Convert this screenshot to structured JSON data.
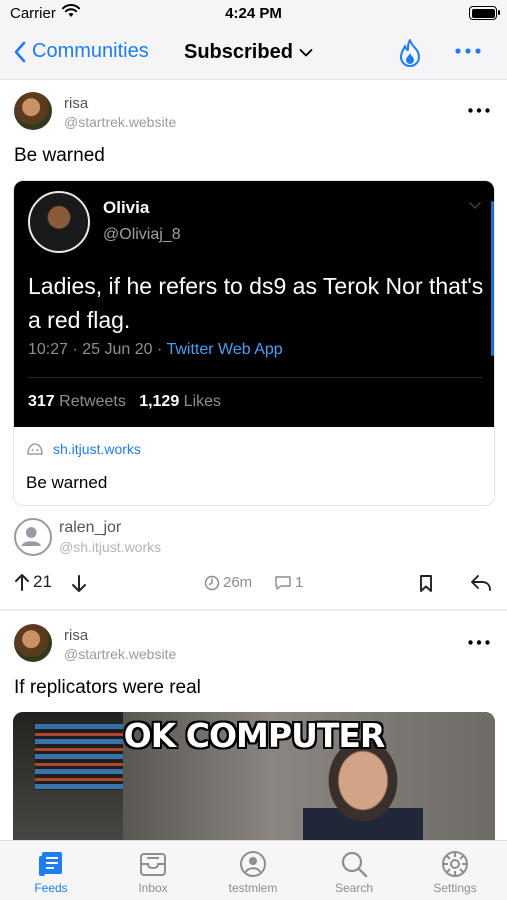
{
  "status_bar": {
    "carrier": "Carrier",
    "time": "4:24 PM"
  },
  "navbar": {
    "back_label": "Communities",
    "title": "Subscribed"
  },
  "posts": [
    {
      "author": "risa",
      "instance": "@startrek.website",
      "title": "Be warned",
      "tweet": {
        "name": "Olivia",
        "handle": "@Oliviaj_8",
        "text": "Ladies, if he refers to ds9 as Terok Nor that's a red flag.",
        "timestamp": "10:27 · 25 Jun 20 · ",
        "app": "Twitter Web App",
        "retweets_count": "317",
        "retweets_label": " Retweets",
        "likes_count": "1,129",
        "likes_label": " Likes"
      },
      "link_host": "sh.itjust.works",
      "link_title": "Be warned",
      "crosspost_author": "ralen_jor",
      "crosspost_instance": "@sh.itjust.works",
      "score": "21",
      "age": "26m",
      "comments": "1"
    },
    {
      "author": "risa",
      "instance": "@startrek.website",
      "title": "If replicators were real",
      "image_caption": "OK COMPUTER"
    }
  ],
  "tabs": [
    {
      "label": "Feeds",
      "icon": "feeds-icon",
      "active": true
    },
    {
      "label": "Inbox",
      "icon": "inbox-icon"
    },
    {
      "label": "testmlem",
      "icon": "profile-icon"
    },
    {
      "label": "Search",
      "icon": "search-icon"
    },
    {
      "label": "Settings",
      "icon": "settings-icon"
    }
  ],
  "colors": {
    "accent": "#1f7cf2",
    "tweet_bg": "#000000",
    "tweet_link": "#4a9ff5"
  }
}
